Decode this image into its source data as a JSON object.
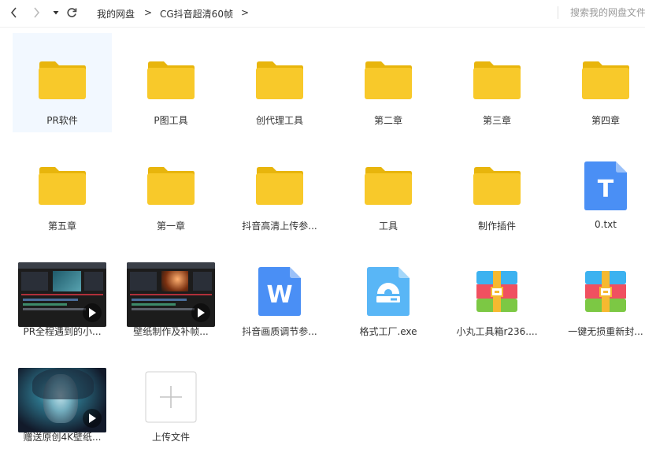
{
  "nav": {
    "breadcrumbs": [
      "我的网盘",
      "CG抖音超清60帧"
    ],
    "search_placeholder": "搜索我的网盘文件"
  },
  "files": [
    {
      "name": "PR软件",
      "type": "folder",
      "selected": true
    },
    {
      "name": "P图工具",
      "type": "folder"
    },
    {
      "name": "创代理工具",
      "type": "folder"
    },
    {
      "name": "第二章",
      "type": "folder"
    },
    {
      "name": "第三章",
      "type": "folder"
    },
    {
      "name": "第四章",
      "type": "folder"
    },
    {
      "name": "第五章",
      "type": "folder"
    },
    {
      "name": "第一章",
      "type": "folder"
    },
    {
      "name": "抖音高清上传参...",
      "type": "folder"
    },
    {
      "name": "工具",
      "type": "folder"
    },
    {
      "name": "制作插件",
      "type": "folder"
    },
    {
      "name": "0.txt",
      "type": "txt",
      "icon_letter": "T"
    },
    {
      "name": "PR全程遇到的小...",
      "type": "video"
    },
    {
      "name": "壁纸制作及补帧...",
      "type": "video"
    },
    {
      "name": "抖音画质调节参...",
      "type": "word",
      "icon_letter": "W"
    },
    {
      "name": "格式工厂.exe",
      "type": "exe"
    },
    {
      "name": "小丸工具箱r236....",
      "type": "archive"
    },
    {
      "name": "一键无损重新封...",
      "type": "archive"
    },
    {
      "name": "赠送原创4K壁纸...",
      "type": "video"
    },
    {
      "name": "上传文件",
      "type": "upload"
    }
  ],
  "colors": {
    "folder": "#f8c92a",
    "folder_tab": "#e8b50c",
    "txt": "#4a8ff5",
    "word": "#4a8ff5",
    "exe": "#59b6f6",
    "selected_bg": "#f2f8ff"
  }
}
